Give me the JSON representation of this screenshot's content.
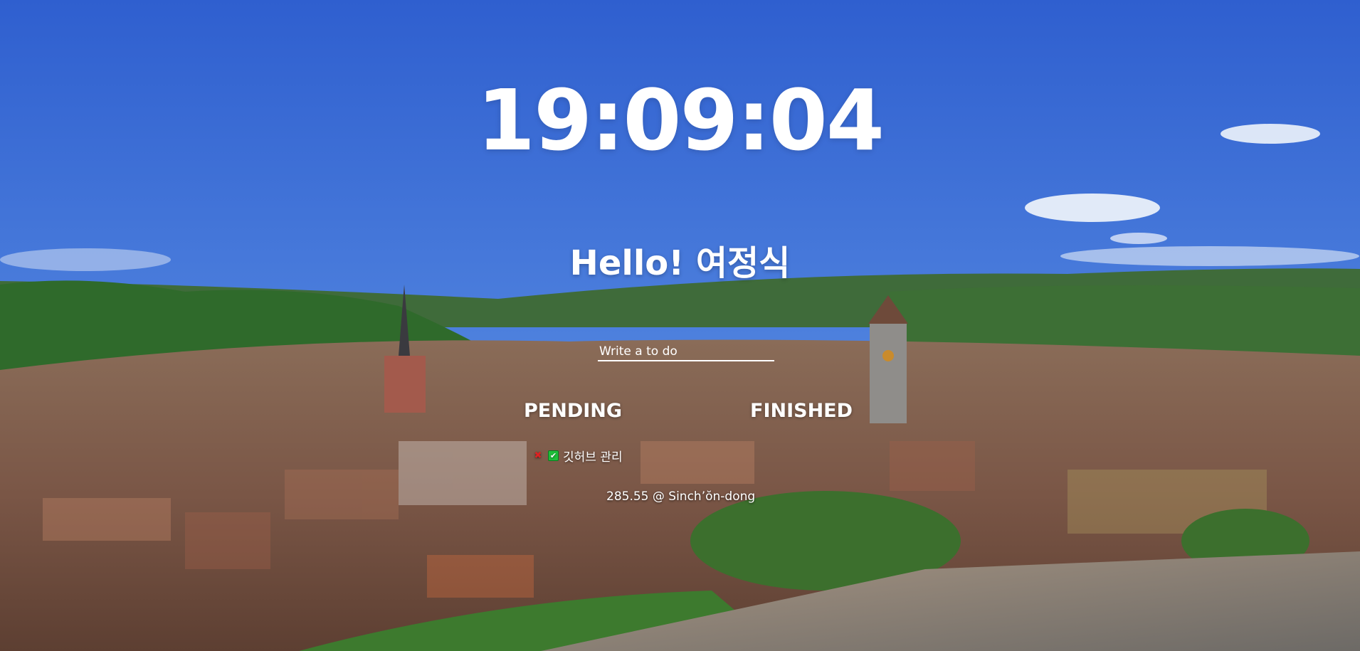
{
  "clock": {
    "time": "19:09:04"
  },
  "greeting": {
    "text": "Hello! 여정식"
  },
  "todo_form": {
    "placeholder": "Write a to do"
  },
  "lists": {
    "pending_title": "PENDING",
    "finished_title": "FINISHED",
    "pending_items": [
      {
        "text": "깃허브 관리",
        "delete_icon": "x-icon",
        "finish_icon": "check-icon"
      }
    ]
  },
  "weather": {
    "text": "285.55 @ Sinch’ŏn-dong"
  }
}
